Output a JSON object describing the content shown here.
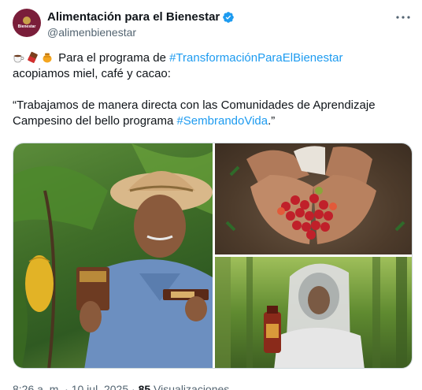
{
  "account": {
    "display_name": "Alimentación para el Bienestar",
    "handle": "@alimenbienestar",
    "avatar_label": "Bienestar",
    "verified_color": "#1d9bf0"
  },
  "tweet": {
    "line1_prefix": "Para el programa de ",
    "hashtag1": "#TransformaciónParaElBienestar",
    "line2": "acopiamos miel, café y cacao:",
    "line3": "“Trabajamos de manera directa con las Comunidades de Aprendizaje",
    "line4_prefix": "Campesino del bello programa ",
    "hashtag2": "#SembrandoVida",
    "line4_suffix": ".”",
    "emojis": [
      "coffee-cup-icon",
      "chocolate-bar-icon",
      "honey-pot-icon"
    ]
  },
  "media": [
    {
      "description": "farmer-holding-cacao-products"
    },
    {
      "description": "hands-holding-coffee-cherries"
    },
    {
      "description": "beekeeper-holding-honey"
    }
  ],
  "footer": {
    "time": "8:26 a. m.",
    "sep1": " · ",
    "date": "10 jul. 2025",
    "sep2": " · ",
    "views_count": "85",
    "views_label": " Visualizaciones"
  },
  "colors": {
    "text": "#0f1419",
    "secondary": "#536471",
    "link": "#1d9bf0",
    "avatar_bg": "#7a1e3a"
  }
}
